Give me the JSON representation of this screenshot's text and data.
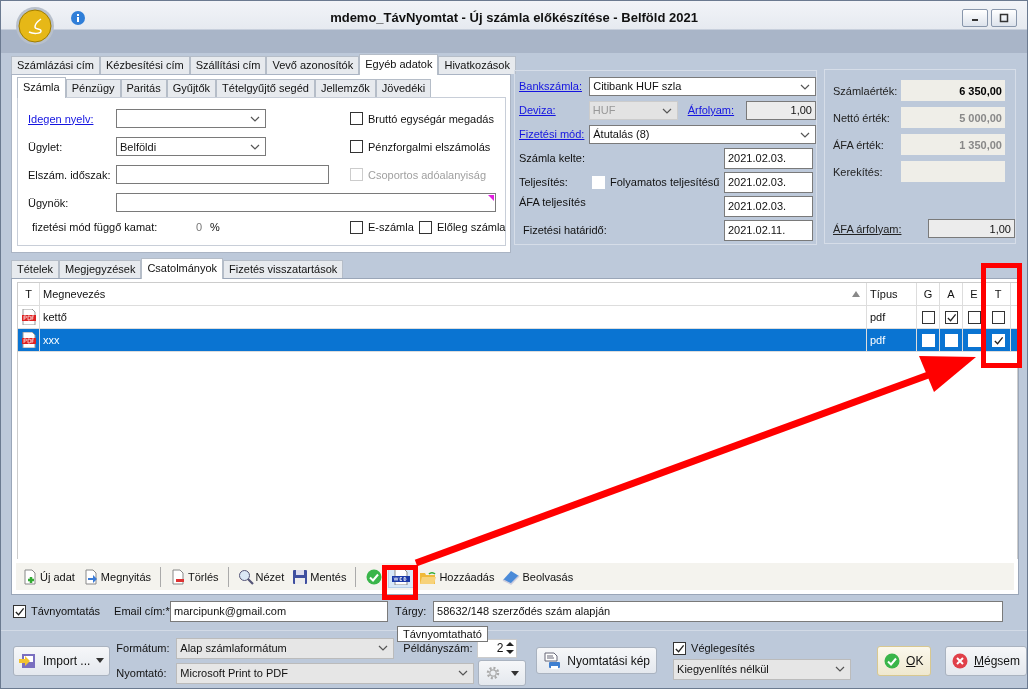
{
  "window": {
    "title": "mdemo_TávNyomtat - Új számla előkészítése - Belföld 2021"
  },
  "top_tabs": [
    {
      "label": "Számlázási cím",
      "selected": false
    },
    {
      "label": "Kézbesítési cím",
      "selected": false
    },
    {
      "label": "Szállítási cím",
      "selected": false
    },
    {
      "label": "Vevő azonosítók",
      "selected": false
    },
    {
      "label": "Egyéb adatok",
      "selected": true
    },
    {
      "label": "Hivatkozások",
      "selected": false
    }
  ],
  "sub_tabs": [
    {
      "label": "Számla",
      "selected": true
    },
    {
      "label": "Pénzügy",
      "selected": false
    },
    {
      "label": "Paritás",
      "selected": false
    },
    {
      "label": "Gyűjtők",
      "selected": false
    },
    {
      "label": "Tételgyűjtő segéd",
      "selected": false
    },
    {
      "label": "Jellemzők",
      "selected": false
    },
    {
      "label": "Jövedéki",
      "selected": false
    }
  ],
  "invoice_form": {
    "foreign_language": {
      "label": "Idegen nyelv:"
    },
    "transaction": {
      "label": "Ügylet:",
      "value": "Belföldi"
    },
    "settlement_period": {
      "label": "Elszám. időszak:"
    },
    "agent": {
      "label": "Ügynök:"
    },
    "interest": {
      "label": "fizetési mód függő kamat:",
      "value": "0",
      "unit": "%"
    },
    "options": [
      {
        "label": "Bruttó egységár megadás",
        "checked": false,
        "disabled": false
      },
      {
        "label": "Pénzforgalmi elszámolás",
        "checked": false,
        "disabled": false
      },
      {
        "label": "Csoportos adóalanyiság",
        "checked": false,
        "disabled": true
      }
    ],
    "e_invoice": {
      "label": "E-számla",
      "checked": false
    },
    "advance_invoice": {
      "label": "Előleg számla",
      "checked": false
    }
  },
  "payment": {
    "bank_account": {
      "label": "Bankszámla:",
      "value": "Citibank HUF szla"
    },
    "currency": {
      "label": "Deviza:",
      "value": "HUF",
      "disabled": true
    },
    "rate": {
      "label": "Árfolyam:",
      "value": "1,00"
    },
    "payment_method": {
      "label": "Fizetési mód:",
      "value": "Átutalás (8)"
    },
    "invoice_date": {
      "label": "Számla kelte:",
      "value": "2021.02.03."
    },
    "fulfilment": {
      "label": "Teljesítés:",
      "value": "2021.02.03.",
      "continuous": {
        "label": "Folyamatos teljesítésű",
        "checked": false
      }
    },
    "vat_fulfilment": {
      "label": "ÁFA teljesítés",
      "value": "2021.02.03."
    },
    "due_date": {
      "label": "Fizetési határidő:",
      "value": "2021.02.11."
    }
  },
  "totals": {
    "rows": [
      {
        "label": "Számlaérték:",
        "value": "6 350,00",
        "kind": "total"
      },
      {
        "label": "Nettó érték:",
        "value": "5 000,00",
        "kind": "readonly"
      },
      {
        "label": "ÁFA érték:",
        "value": "1 350,00",
        "kind": "readonly"
      },
      {
        "label": "Kerekítés:",
        "kind": "readonly"
      }
    ],
    "vat_rate": {
      "label": "ÁFA árfolyam:",
      "value": "1,00"
    }
  },
  "bottom_tabs": [
    {
      "label": "Tételek",
      "selected": false
    },
    {
      "label": "Megjegyzések",
      "selected": false
    },
    {
      "label": "Csatolmányok",
      "selected": true
    },
    {
      "label": "Fizetés visszatartások",
      "selected": false
    }
  ],
  "attachments": {
    "columns": [
      "T",
      "Megnevezés",
      "Típus",
      "G",
      "A",
      "E",
      "T"
    ],
    "rows": [
      {
        "name": "kettő",
        "type": "pdf",
        "g": false,
        "a": true,
        "e": false,
        "t": false,
        "selected": false
      },
      {
        "name": "xxx",
        "type": "pdf",
        "g": false,
        "a": false,
        "e": false,
        "t": true,
        "selected": true
      }
    ]
  },
  "toolbar": [
    {
      "kind": "button",
      "label": "Új adat",
      "hovered": false
    },
    {
      "kind": "button",
      "label": "Megnyitás",
      "hovered": false
    },
    {
      "kind": "separator"
    },
    {
      "kind": "button",
      "label": "Törlés",
      "hovered": false
    },
    {
      "kind": "separator"
    },
    {
      "kind": "button",
      "label": "Nézet",
      "hovered": false
    },
    {
      "kind": "button",
      "label": "Mentés",
      "hovered": false
    },
    {
      "kind": "separator"
    },
    {
      "kind": "icon-button",
      "hovered": false
    },
    {
      "kind": "icon-button",
      "hovered": true
    },
    {
      "kind": "button",
      "label": "Hozzáadás",
      "hovered": false
    },
    {
      "kind": "button",
      "label": "Beolvasás",
      "hovered": false
    }
  ],
  "tooltip": "Távnyomtatható",
  "remote_print": {
    "label": "Távnyomtatás",
    "checked": true
  },
  "email": {
    "label": "Email cím:*",
    "value": "marcipunk@gmail.com"
  },
  "subject": {
    "label": "Tárgy:",
    "value": "58632/148 szerződés szám alapján"
  },
  "print": {
    "import_button": "Import ...",
    "format": {
      "label": "Formátum:",
      "value": "Alap számlaformátum"
    },
    "printer": {
      "label": "Nyomtató:",
      "value": "Microsoft Print to PDF"
    },
    "copies": {
      "label": "Példányszám:",
      "value": "2"
    },
    "preview_button": "Nyomtatási kép",
    "finalize": {
      "label": "Véglegesítés",
      "checked": true
    },
    "settlement": {
      "value": "Kiegyenlítés nélkül"
    }
  },
  "ok_button": "OK",
  "cancel_button": "Mégsem"
}
